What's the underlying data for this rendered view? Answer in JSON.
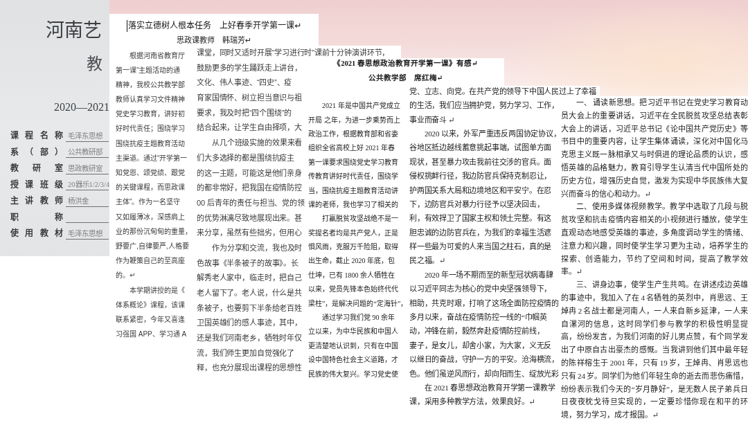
{
  "cover": {
    "title": "河南艺",
    "subtitle": "教",
    "years": "2020—2021",
    "fields": [
      {
        "label": "课程名称",
        "value": "毛泽东思想"
      },
      {
        "label": "系（部）",
        "value": "公共教研部"
      },
      {
        "label": "教研室",
        "value": "思政教研室"
      },
      {
        "label": "授课班级",
        "value": "20器乐1/2/3/4"
      },
      {
        "label": "主讲教师",
        "value": "杨洪金"
      },
      {
        "label": "职称"
      },
      {
        "label": "使用教材",
        "value": "毛泽东思想"
      }
    ]
  },
  "essay_1_page_1": {
    "title": "落实立德树人根本任务　上好春季开学第一课↵",
    "byline": "思政课教师　韩瑞芳↵",
    "lines": [
      {
        "kind": "para",
        "text": "根据河南省教育厅"
      },
      {
        "kind": "line",
        "text": "第一课”主题活动的通"
      },
      {
        "kind": "line",
        "text": "精神，我校公共教学部"
      },
      {
        "kind": "line",
        "text": "教师认真学习文件精神"
      },
      {
        "kind": "line",
        "text": "党史学习教育，讲好初"
      },
      {
        "kind": "line",
        "text": "好时代责任；围绕学习"
      },
      {
        "kind": "line",
        "text": "围绕抗疫主题教育活动"
      },
      {
        "kind": "line",
        "text": "主渠道。通过“开学第一"
      },
      {
        "kind": "line",
        "text": "知党恩、颂党绩、跟党"
      },
      {
        "kind": "line",
        "text": "的关键课程，而思政课"
      },
      {
        "kind": "line",
        "text": "主体”。作为一名坚守"
      },
      {
        "kind": "line",
        "text": "又如履薄冰，深感肩上"
      },
      {
        "kind": "line",
        "text": "业的那份沉甸甸的重量，"
      },
      {
        "kind": "line",
        "text": "野要广,自律要严,人格要"
      },
      {
        "kind": "line",
        "text": "作为鞭策自己的至高座"
      },
      {
        "kind": "line",
        "text": "的。↵"
      },
      {
        "kind": "para",
        "text": "本学期讲授的是《"
      },
      {
        "kind": "line",
        "text": "体系概论》课程，该课"
      },
      {
        "kind": "line",
        "text": "联系紧密，今年又喜逢"
      },
      {
        "kind": "line",
        "text": "习强国 APP、学习通 A"
      }
    ]
  },
  "essay_1_page_2": {
    "lines": [
      {
        "kind": "line",
        "text": "课堂，同时又适时开展“学习进行时”课前十分钟演讲环节，"
      },
      {
        "kind": "line",
        "text": "鼓励更多的学生踊跃走上讲台，"
      },
      {
        "kind": "line",
        "text": "文化、伟人事迹、“四史”、疫"
      },
      {
        "kind": "line",
        "text": "育家国情怀、树立担当意识与祖"
      },
      {
        "kind": "line",
        "text": "要求，我及时把“四个围绕”的"
      },
      {
        "kind": "line",
        "text": "结合起来，让学生自由择项，大"
      },
      {
        "kind": "para",
        "text": "从几个班级实施的效果来看"
      },
      {
        "kind": "line",
        "text": "们大多选择的都是围绕抗疫主"
      },
      {
        "kind": "line",
        "text": "的这一主题，可能这是他们亲身"
      },
      {
        "kind": "line",
        "text": "的都非常好，把我国在疫情防控"
      },
      {
        "kind": "line",
        "text": "00 后青年的责任与担当、党的领"
      },
      {
        "kind": "line",
        "text": "的优势淋漓尽致地展现出来。甚"
      },
      {
        "kind": "line",
        "text": "来分享，虽然有些拙劣，但用心"
      },
      {
        "kind": "para",
        "text": "作为分享和交流，我也及时"
      },
      {
        "kind": "line",
        "text": "色故事《半条被子的故事》。长"
      },
      {
        "kind": "line",
        "text": "解秀老人家中，临走时，把自己"
      },
      {
        "kind": "line",
        "text": "老人留下了。老人说，什么是共"
      },
      {
        "kind": "line",
        "text": "条被子，也要剪下半条给老百姓"
      },
      {
        "kind": "line",
        "text": "卫国英雄们的感人事迹，其中，"
      },
      {
        "kind": "line",
        "text": "还是我们河南老乡，牺牲时年仅"
      },
      {
        "kind": "line",
        "text": "流，我们师生更加自觉强化了"
      },
      {
        "kind": "line",
        "text": "释，也充分展现出课程的思想性"
      }
    ]
  },
  "essay_2_page_1": {
    "title": "《2021 春思想政治教育开学第一课》有感↵",
    "byline": "公共教学部　席红梅↵",
    "lines": [
      {
        "kind": "para",
        "text": "2021 年是中国共产党成立"
      },
      {
        "kind": "line",
        "text": "开局 之年，为进一步乘势而上"
      },
      {
        "kind": "line",
        "text": "政治工作，根据教育部和省委"
      },
      {
        "kind": "line",
        "text": "组织全省高校上好 2021 年春"
      },
      {
        "kind": "line",
        "text": "第一课要求围绕党史学习教育"
      },
      {
        "kind": "line",
        "text": "传教育讲好时代责任，围绕学"
      },
      {
        "kind": "line",
        "text": "当，围绕抗疫主题教育活动讲"
      },
      {
        "kind": "line",
        "text": "课的老师，我也学习了相关的"
      },
      {
        "kind": "para",
        "text": "打赢脱贫攻坚战绝不是一"
      },
      {
        "kind": "line",
        "text": "奖提名者均是共产党人，正是"
      },
      {
        "kind": "line",
        "text": "惧风雨，克服万千险阻，取得"
      },
      {
        "kind": "line",
        "text": "出生命，截止 2020 年底，包"
      },
      {
        "kind": "line",
        "text": "仕坤，已有 1800 余人牺牲在"
      },
      {
        "kind": "line",
        "text": "以来，党员先锋本色始终代代"
      },
      {
        "kind": "line",
        "text": "梁柱”，是解决问题的“定海针”，"
      },
      {
        "kind": "para",
        "text": "通过学习我们党 90 余年"
      },
      {
        "kind": "line",
        "text": "立以来，为中华民族和中国人"
      },
      {
        "kind": "line",
        "text": "更清楚地认识到，只有在中国"
      },
      {
        "kind": "line",
        "text": "设中国特色社会主义道路，才"
      },
      {
        "kind": "line",
        "text": "民族的伟大复兴。学习党史使"
      }
    ]
  },
  "essay_2_right_column": {
    "lines": [
      {
        "kind": "line",
        "text": "党、立志、向党。在共产党的领导下中国人民过上了幸福"
      },
      {
        "kind": "line",
        "text": "的生活，我们应当拥护党，努力学习、工作，"
      },
      {
        "kind": "line",
        "text": "事业而奋斗 ↵"
      },
      {
        "kind": "para",
        "text": "2020 以来，外军严重违反两国协定协议，"
      },
      {
        "kind": "line",
        "text": "谷地区抵边越线蓄意挑起事端，试图单方面"
      },
      {
        "kind": "line",
        "text": "现状，甚至暴力攻击我前往交涉的官兵。面"
      },
      {
        "kind": "line",
        "text": "侵权挑衅行径，我边防官兵保持克制忍让，"
      },
      {
        "kind": "line",
        "text": "护两国关系大局和边境地区和平安宁。在忍"
      },
      {
        "kind": "line",
        "text": "下，边防官兵对暴力行径予以坚决回击，"
      },
      {
        "kind": "line",
        "text": "利，有效捍卫了国家主权和领土完整。有这"
      },
      {
        "kind": "line",
        "text": "胆忠诚的边防官兵在，为我们的幸福生活遮"
      },
      {
        "kind": "line",
        "text": "样一些最为可爱的人来当国之柱石，真的是"
      },
      {
        "kind": "line",
        "text": "民之福。↵"
      },
      {
        "kind": "para",
        "text": "2020 年一场不期而至的新型冠状病毒肆"
      },
      {
        "kind": "line",
        "text": "以习近平同志为核心的党中央坚强领导下，"
      },
      {
        "kind": "line",
        "text": "相助，共克时艰，打响了这场全面防控疫情的"
      },
      {
        "kind": "line",
        "text": "多月以来，奋战在疫情防控一线的“巾帼英"
      },
      {
        "kind": "line",
        "text": "动，冲锋在前，毅然奔赴疫情防控前线，"
      },
      {
        "kind": "line",
        "text": "妻子，是女儿，却舍小家，为大家，义无反"
      },
      {
        "kind": "line",
        "text": "以继日的奋战，守护一方的平安。沧海横流，"
      },
      {
        "kind": "line",
        "text": "色。他们虽逆风而行，却向阳而生、绽放光彩"
      },
      {
        "kind": "para",
        "text": "在 2021 春思想政治教育开学第一课教学"
      },
      {
        "kind": "line",
        "text": "课，采用多种教学方法，效果良好。↵"
      }
    ]
  },
  "essay_2_page_2": {
    "paragraphs": [
      "一、 诵读新思想。把习近平书记在党史学习教育动员大会上的重要讲话，习近平在全民脱贫攻坚总结表彰大会上的讲话，习近平总书记《论中国共产党历史》等书目中的重要内容，让学生集体诵读，深化对中国化马克思主义既一脉相承又与时俱进的理论品质的认识，感悟英雄的品格魅力，教育引导学生认清当代中国所处的历史方位，增强历史自觉，激发为实现中华民族伟大复兴而奋斗的信心和动力。↵",
      "二、使用多媒体视频教学。教学中选取了几段与脱贫攻坚和抗击疫情内容相关的小视频进行播放，使学生直观动态地感受英雄的事迹，多角度调动学生的情绪、注意力和兴趣，同时使学生学习更为主动，培养学生的探索、创造能力，节约了空间和时间，提高了教学效率。↵",
      "三、讲身边事，使学生产生共鸣。在讲述戍边英雄的事迹中，我加入了在 4 名牺牲的英烈中，肖思远、王焯冉 2 名战士都是河南人，一人来自新乡延津，一人来自漯河的信息，这时同学们参与教学的积极性明显提高，纷纷发言，为我们河南的好儿男点赞，有个同学发出了中原自古出豪杰的感慨。当我讲到他们其中最年轻的陈祥榕生于 2001 年，只有 19 岁，王焯冉、肖思远也只有 24 岁。同学们为他们年轻生命的逝去而悲伤痛惜，纷纷表示我们今天的“岁月静好”，是无数人民子弟兵日日夜夜枕戈待旦实现的，一定要珍惜你现在和平的环境，努力学习，成才报国。↵"
    ]
  }
}
